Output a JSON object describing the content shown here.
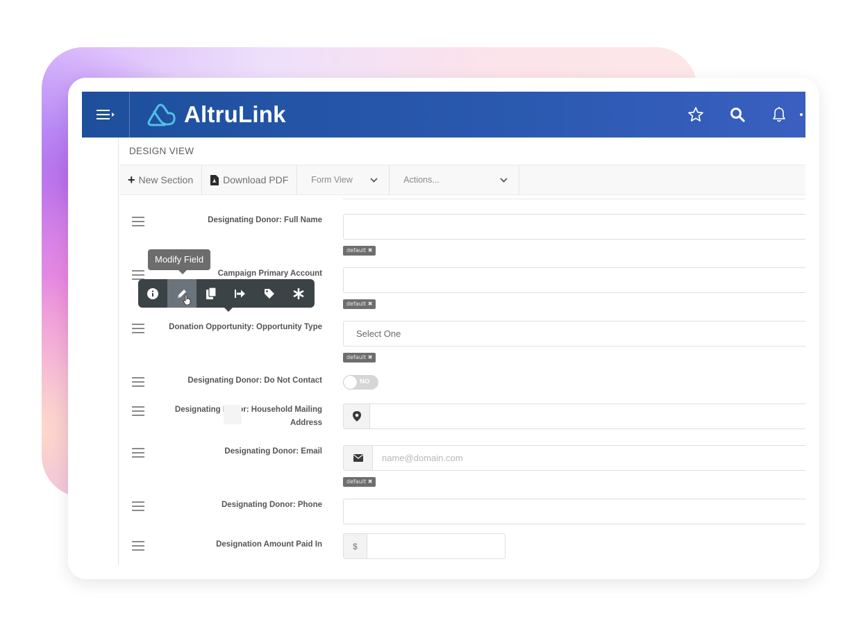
{
  "app": {
    "brand": "AltruLink",
    "colors": {
      "header": "#2a59b0",
      "accent": "#4fc3e8",
      "popup": "#3c4347"
    }
  },
  "header": {
    "icons": [
      "menu-icon",
      "star-icon",
      "search-icon",
      "bell-icon"
    ]
  },
  "page": {
    "title": "DESIGN VIEW"
  },
  "toolbar": {
    "new_section": "New Section",
    "download_pdf": "Download PDF",
    "view_select": "Form View",
    "actions_select": "Actions..."
  },
  "popup": {
    "tooltip": "Modify Field",
    "buttons": [
      "info-icon",
      "pencil-icon",
      "copy-icon",
      "move-icon",
      "tag-icon",
      "asterisk-icon"
    ],
    "active": "pencil-icon"
  },
  "fields": [
    {
      "label": "Designating Donor: Full Name",
      "type": "text",
      "value": "",
      "tag": "default"
    },
    {
      "label": "Campaign Primary Account",
      "type": "text",
      "value": "",
      "tag": "default"
    },
    {
      "label": "Donation Opportunity: Opportunity Type",
      "type": "select",
      "value": "Select One",
      "tag": "default"
    },
    {
      "label": "Designating Donor: Do Not Contact",
      "type": "toggle",
      "value": "NO"
    },
    {
      "label_line1": "Designating Donor: Household Mailing",
      "label_line2": "Address",
      "type": "address",
      "value": ""
    },
    {
      "label": "Designating Donor: Email",
      "type": "email",
      "placeholder": "name@domain.com",
      "tag": "default"
    },
    {
      "label": "Designating Donor: Phone",
      "type": "text",
      "value": ""
    },
    {
      "label": "Designation Amount Paid In",
      "type": "currency",
      "prefix": "$",
      "value": ""
    }
  ],
  "tag_close": "✖"
}
